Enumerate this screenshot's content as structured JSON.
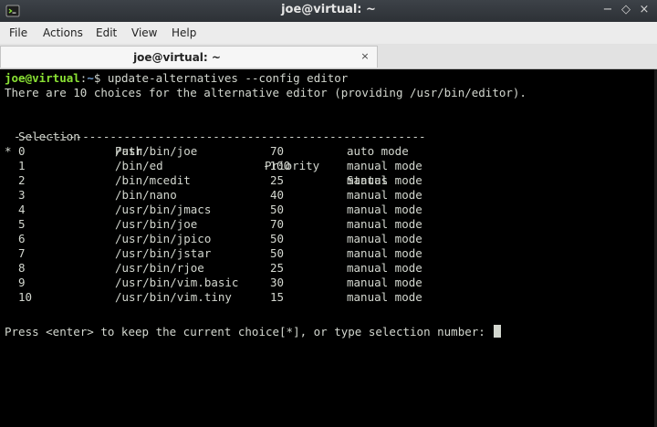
{
  "window": {
    "title": "joe@virtual: ~",
    "controls": {
      "minimize": "−",
      "maximize": "◇",
      "close": "×"
    }
  },
  "menu": [
    "File",
    "Actions",
    "Edit",
    "View",
    "Help"
  ],
  "tab": {
    "label": "joe@virtual: ~",
    "close": "×"
  },
  "terminal": {
    "prompt": {
      "user": "joe@virtual",
      "sep": ":",
      "path": "~",
      "symbol": "$ "
    },
    "command": "update-alternatives --config editor",
    "info": "There are 10 choices for the alternative editor (providing /usr/bin/editor).",
    "headers": {
      "selection": "Selection",
      "path": "Path",
      "priority": "Priority",
      "status": "Status"
    },
    "divider": "------------------------------------------------------------",
    "rows": [
      {
        "marker": "*",
        "selection": "0",
        "path": "/usr/bin/joe",
        "priority": "70",
        "status": "auto mode"
      },
      {
        "marker": "",
        "selection": "1",
        "path": "/bin/ed",
        "priority": "-100",
        "status": "manual mode"
      },
      {
        "marker": "",
        "selection": "2",
        "path": "/bin/mcedit",
        "priority": "25",
        "status": "manual mode"
      },
      {
        "marker": "",
        "selection": "3",
        "path": "/bin/nano",
        "priority": "40",
        "status": "manual mode"
      },
      {
        "marker": "",
        "selection": "4",
        "path": "/usr/bin/jmacs",
        "priority": "50",
        "status": "manual mode"
      },
      {
        "marker": "",
        "selection": "5",
        "path": "/usr/bin/joe",
        "priority": "70",
        "status": "manual mode"
      },
      {
        "marker": "",
        "selection": "6",
        "path": "/usr/bin/jpico",
        "priority": "50",
        "status": "manual mode"
      },
      {
        "marker": "",
        "selection": "7",
        "path": "/usr/bin/jstar",
        "priority": "50",
        "status": "manual mode"
      },
      {
        "marker": "",
        "selection": "8",
        "path": "/usr/bin/rjoe",
        "priority": "25",
        "status": "manual mode"
      },
      {
        "marker": "",
        "selection": "9",
        "path": "/usr/bin/vim.basic",
        "priority": "30",
        "status": "manual mode"
      },
      {
        "marker": "",
        "selection": "10",
        "path": "/usr/bin/vim.tiny",
        "priority": "15",
        "status": "manual mode"
      }
    ],
    "input_prompt": "Press <enter> to keep the current choice[*], or type selection number: "
  },
  "colors": {
    "prompt_user": "#8ae234",
    "prompt_path": "#729fcf",
    "text": "#d3d7cf",
    "background": "#000000"
  },
  "icons": {
    "app": "terminal-icon",
    "tab_close": "close-icon"
  }
}
